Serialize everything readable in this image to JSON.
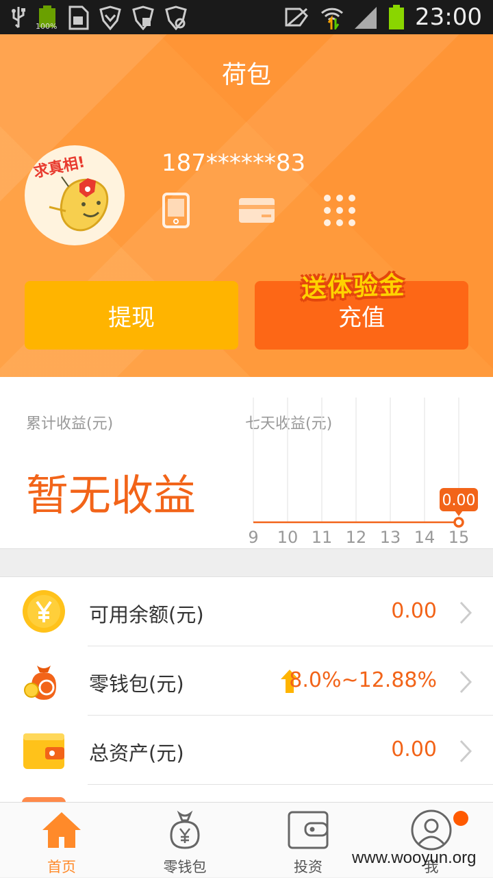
{
  "status_bar": {
    "time": "23:00",
    "battery_text": "100%"
  },
  "header": {
    "title": "荷包"
  },
  "account": {
    "phone": "187******83",
    "avatar_caption": "求真相!"
  },
  "actions": {
    "withdraw_label": "提现",
    "recharge_label": "充值",
    "promo_label": "送体验金"
  },
  "earnings": {
    "total_label": "累计收益(元)",
    "total_value": "暂无收益",
    "week_label": "七天收益(元)",
    "week_tooltip": "0.00"
  },
  "chart_data": {
    "type": "line",
    "x": [
      9,
      10,
      11,
      12,
      13,
      14,
      15
    ],
    "series": [
      {
        "values": [
          0,
          0,
          0,
          0,
          0,
          0,
          0
        ]
      }
    ],
    "title": "七天收益(元)",
    "xlabel": "",
    "ylabel": "",
    "grid": "vertical",
    "highlight": {
      "x": 15,
      "y": 0.0,
      "label": "0.00"
    }
  },
  "list": {
    "items": [
      {
        "label": "可用余额(元)",
        "value": "0.00",
        "icon": "yuan-coin-icon"
      },
      {
        "label": "零钱包(元)",
        "value": "8.0%~12.88%",
        "icon": "money-bag-icon"
      },
      {
        "label": "总资产(元)",
        "value": "0.00",
        "icon": "wallet-icon"
      }
    ]
  },
  "tabs": [
    {
      "label": "首页",
      "icon": "home-icon",
      "active": true
    },
    {
      "label": "零钱包",
      "icon": "money-bag-icon",
      "active": false
    },
    {
      "label": "投资",
      "icon": "wallet-icon",
      "active": false
    },
    {
      "label": "我",
      "icon": "user-icon",
      "active": false
    }
  ],
  "watermark": "www.wooyun.org",
  "colors": {
    "brand_orange": "#ff9a3c",
    "accent_orange": "#f26419",
    "withdraw_yellow": "#ffb400",
    "recharge_orange": "#fd6716"
  }
}
